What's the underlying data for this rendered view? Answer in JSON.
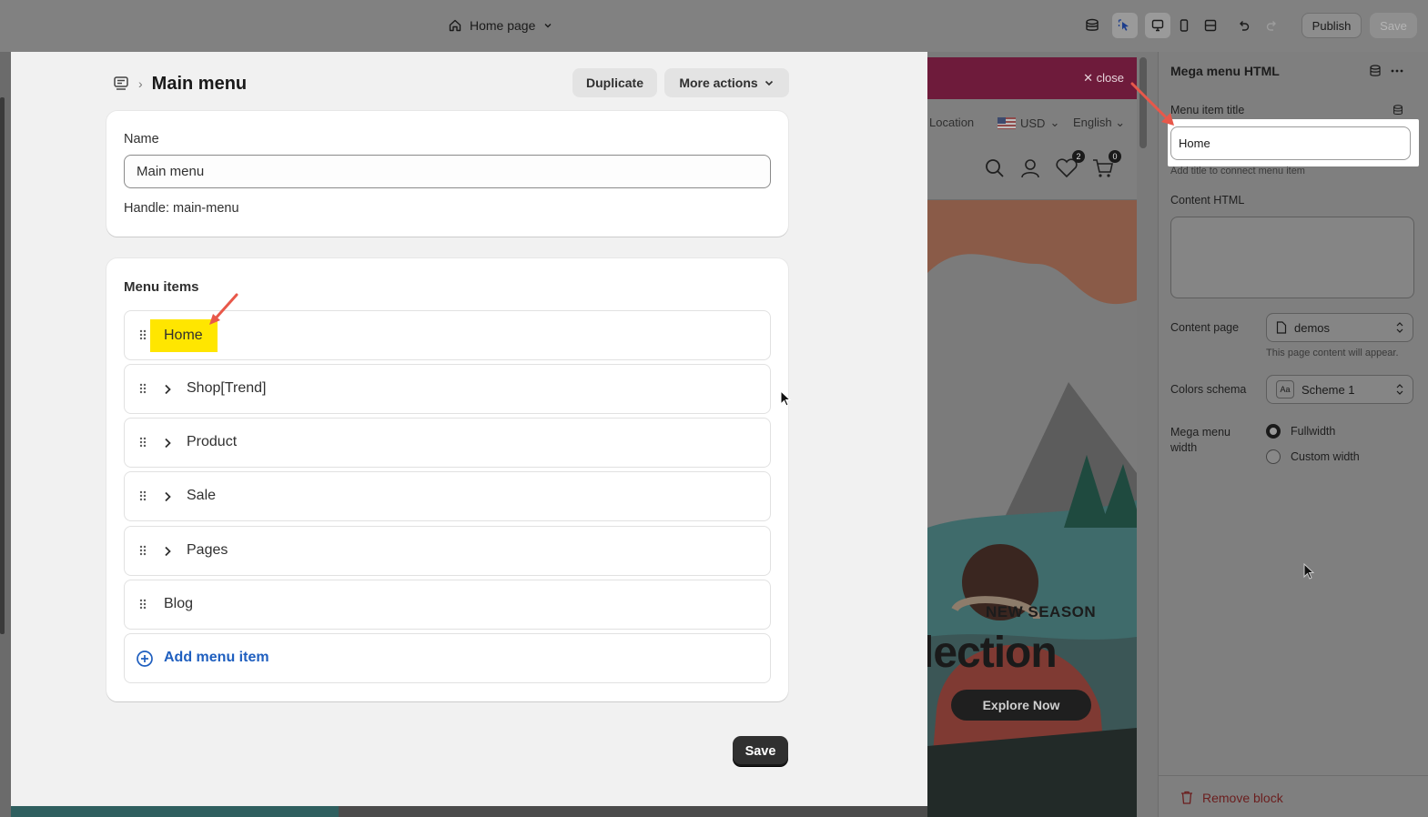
{
  "topbar": {
    "page_label": "Home page",
    "publish_label": "Publish",
    "save_label": "Save"
  },
  "modal": {
    "breadcrumb_title": "Main menu",
    "duplicate_label": "Duplicate",
    "more_actions_label": "More actions",
    "name_label": "Name",
    "name_value": "Main menu",
    "handle_text": "Handle: main-menu",
    "menu_items_heading": "Menu items",
    "items": [
      {
        "label": "Home",
        "expandable": false,
        "highlighted": true
      },
      {
        "label": "Shop[Trend]",
        "expandable": true
      },
      {
        "label": "Product",
        "expandable": true
      },
      {
        "label": "Sale",
        "expandable": true
      },
      {
        "label": "Pages",
        "expandable": true
      },
      {
        "label": "Blog",
        "expandable": false
      }
    ],
    "add_item_label": "Add menu item",
    "save_label": "Save",
    "highlight_color": "#ffe600"
  },
  "preview": {
    "close_label": "close",
    "location_label": "Location",
    "currency_label": "USD",
    "language_label": "English",
    "wishlist_count": "2",
    "cart_count": "0",
    "new_season_label": "NEW SEASON",
    "headline_fragment": "lection",
    "explore_label": "Explore Now"
  },
  "settings_panel": {
    "title": "Mega menu HTML",
    "menu_item_title_label": "Menu item title",
    "menu_item_title_value": "Home",
    "menu_item_title_hint": "Add title to connect menu item",
    "content_html_label": "Content HTML",
    "content_page_label": "Content page",
    "content_page_value": "demos",
    "content_page_hint": "This page content will appear.",
    "colors_schema_label": "Colors schema",
    "colors_schema_value": "Scheme 1",
    "mega_width_label_1": "Mega menu",
    "mega_width_label_2": "width",
    "width_option_fullwidth": "Fullwidth",
    "width_option_custom": "Custom width",
    "selected_width": "Fullwidth",
    "remove_block_label": "Remove block"
  },
  "colors": {
    "annotation_arrow": "#e8584a",
    "link_blue": "#1f5fbf",
    "remove_red": "#6b1e1e"
  }
}
